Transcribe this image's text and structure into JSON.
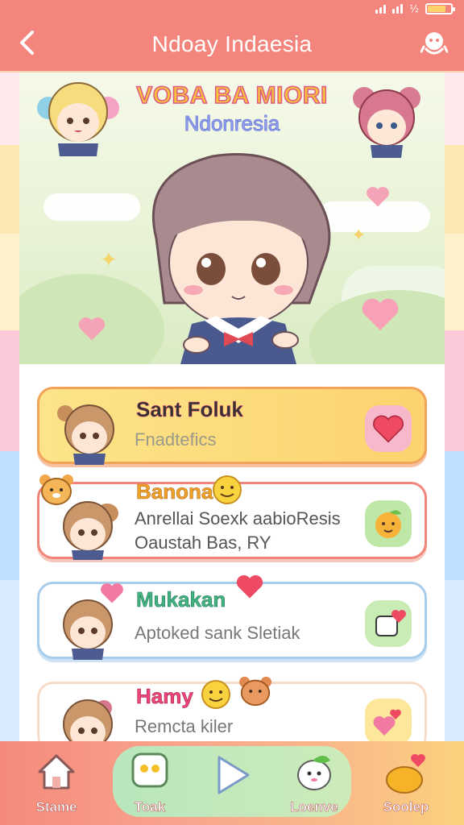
{
  "status": {
    "battery_label": "½"
  },
  "header": {
    "title": "Ndoay Indaesia"
  },
  "banner": {
    "title": "VOBA BA MIORI",
    "subtitle": "Ndonresia",
    "pager_count": 3,
    "pager_active": 0
  },
  "cards": [
    {
      "name": "Sant Foluk",
      "line1": "Fnadtefics",
      "line2": "",
      "name_color": "#f0457a",
      "action": "heart-icon"
    },
    {
      "name": "Banona",
      "line1": "Anrellai Soexk aabioResis",
      "line2": "Oaustah Bas, RY",
      "name_color": "#f0a228",
      "action": "orange-face-icon"
    },
    {
      "name": "Mukakan",
      "line1": "Aptoked sank Sletiak",
      "line2": "",
      "name_color": "#44b383",
      "action": "sticker-heart-icon"
    },
    {
      "name": "Hamy",
      "line1": "Remcta kiler",
      "line2": "",
      "name_color": "#f0457a",
      "action": "hearts-icon"
    }
  ],
  "nav": [
    {
      "label": "Stame",
      "icon": "home-icon"
    },
    {
      "label": "Toak",
      "icon": "chat-icon"
    },
    {
      "label": "",
      "icon": "play-icon"
    },
    {
      "label": "Loenve",
      "icon": "friend-icon"
    },
    {
      "label": "Soolep",
      "icon": "heart-pot-icon"
    }
  ]
}
